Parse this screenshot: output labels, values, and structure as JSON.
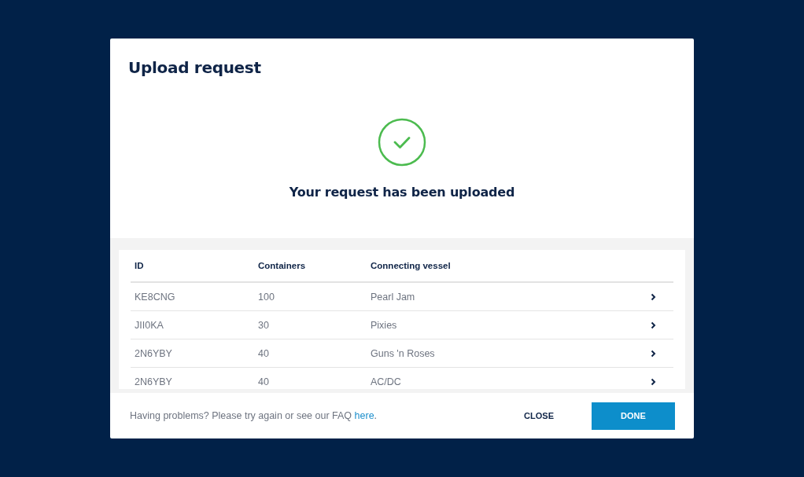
{
  "dialog": {
    "title": "Upload request",
    "message": "Your request has been uploaded"
  },
  "table": {
    "columns": [
      "ID",
      "Containers",
      "Connecting vessel"
    ],
    "rows": [
      {
        "id": "KE8CNG",
        "containers": "100",
        "vessel": "Pearl Jam"
      },
      {
        "id": "JII0KA",
        "containers": "30",
        "vessel": "Pixies"
      },
      {
        "id": "2N6YBY",
        "containers": "40",
        "vessel": "Guns 'n Roses"
      },
      {
        "id": "2N6YBY",
        "containers": "40",
        "vessel": "AC/DC"
      }
    ]
  },
  "footer": {
    "help_text": "Having problems? Please try again or see our FAQ",
    "help_link": "here",
    "help_end": ".",
    "buttons": [
      {
        "label": "CLOSE",
        "kind": "text"
      },
      {
        "label": "DONE",
        "kind": "primary"
      }
    ]
  }
}
